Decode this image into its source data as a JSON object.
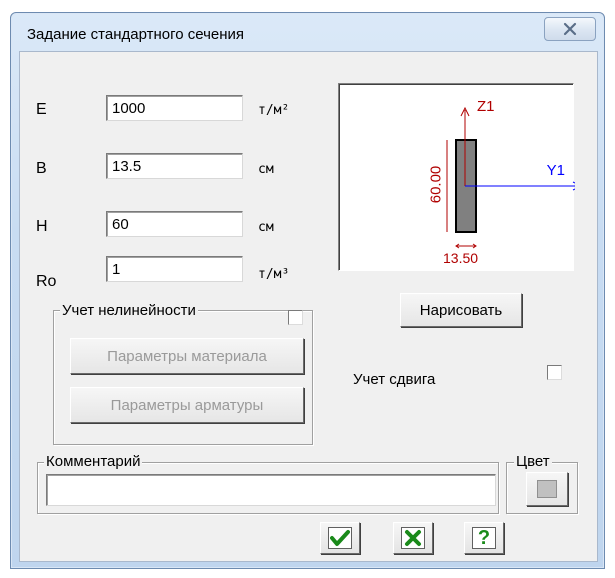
{
  "window": {
    "title": "Задание стандартного сечения",
    "close_label": "X"
  },
  "fields": [
    {
      "label": "E",
      "value": "1000",
      "unit": "т/м²"
    },
    {
      "label": "B",
      "value": "13.5",
      "unit": "см"
    },
    {
      "label": "H",
      "value": "60",
      "unit": "см"
    },
    {
      "label": "Ro",
      "value": "1",
      "unit": "т/м³"
    }
  ],
  "preview": {
    "z_axis": "Z1",
    "y_axis": "Y1",
    "height_dim": "60.00",
    "width_dim": "13.50",
    "colors": {
      "axis": "#0000ff",
      "dimension": "#b00000",
      "section": "#808080"
    }
  },
  "nonlinear": {
    "label": "Учет нелинейности",
    "checked": false,
    "material_params": "Параметры материала",
    "rebar_params": "Параметры арматуры"
  },
  "draw_button": "Нарисовать",
  "shear": {
    "label": "Учет сдвига",
    "checked": false
  },
  "comment": {
    "label": "Комментарий",
    "value": ""
  },
  "color": {
    "label": "Цвет",
    "swatch": "#c0c0c0"
  },
  "buttons": {
    "ok_icon": "checkmark-icon",
    "cancel_icon": "cross-icon",
    "help_icon": "question-icon",
    "ok_color": "#1a8a1a",
    "cancel_color": "#1a8a1a",
    "help_color": "#1a8a1a"
  }
}
